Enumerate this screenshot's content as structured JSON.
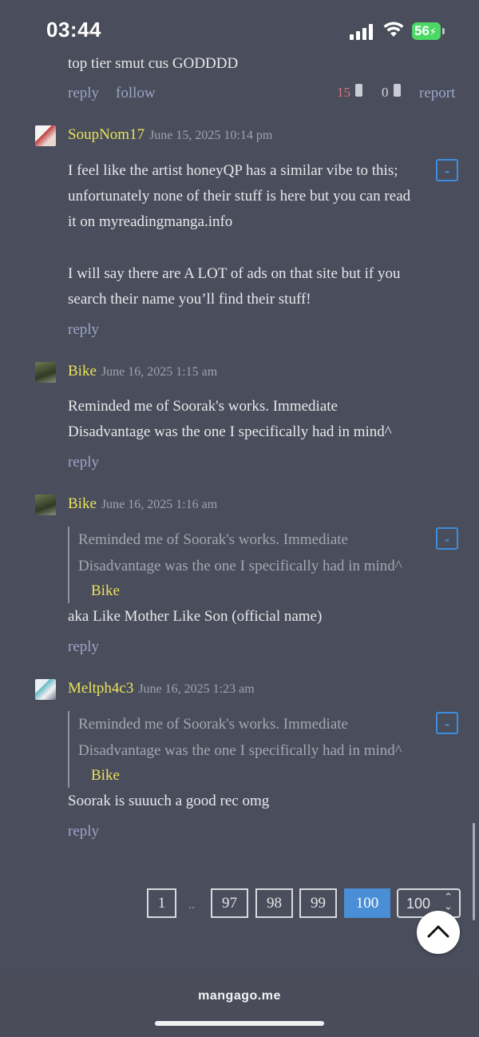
{
  "status": {
    "time": "03:44",
    "battery": "56"
  },
  "top_comment": {
    "text": "top tier smut cus GODDDD",
    "reply": "reply",
    "follow": "follow",
    "likes": "15",
    "dislikes": "0",
    "report": "report"
  },
  "comments": [
    {
      "user": "SoupNom17",
      "date": "June 15, 2025 10:14 pm",
      "text_lines": [
        "I feel like the artist honeyQP has a similar vibe to this;",
        "unfortunately none of their stuff is here but you can read",
        "it on myreadingmanga.info"
      ],
      "text_lines2": [
        "I will say there are A LOT of ads on that site but if you",
        "search their name you’ll find their stuff!"
      ],
      "reply": "reply",
      "collapse": "-"
    },
    {
      "user": "Bike",
      "date": "June 16, 2025 1:15 am",
      "text_lines": [
        "Reminded me of Soorak's works. Immediate",
        "Disadvantage was the one I specifically had in mind^"
      ],
      "reply": "reply"
    },
    {
      "user": "Bike",
      "date": "June 16, 2025 1:16 am",
      "quote_lines": [
        "Reminded me of Soorak's works. Immediate",
        "Disadvantage was the one I specifically had in mind^"
      ],
      "quote_author": "Bike",
      "text": "aka Like Mother Like Son (official name)",
      "reply": "reply",
      "collapse": "-"
    },
    {
      "user": "Meltph4c3",
      "date": "June 16, 2025 1:23 am",
      "quote_lines": [
        "Reminded me of Soorak's works. Immediate",
        "Disadvantage was the one I specifically had in mind^"
      ],
      "quote_author": "Bike",
      "text": "Soorak is suuuch a good rec omg",
      "reply": "reply",
      "collapse": "-"
    }
  ],
  "pagination": {
    "first": "1",
    "ellipsis": "..",
    "pages": [
      "97",
      "98",
      "99"
    ],
    "current": "100",
    "select_value": "100"
  },
  "browser": {
    "domain": "mangago.me"
  },
  "colors": {
    "username": "#e8e25a",
    "link": "#9aa6c8",
    "accent": "#3d8ee0",
    "background": "#4a4d5b"
  }
}
